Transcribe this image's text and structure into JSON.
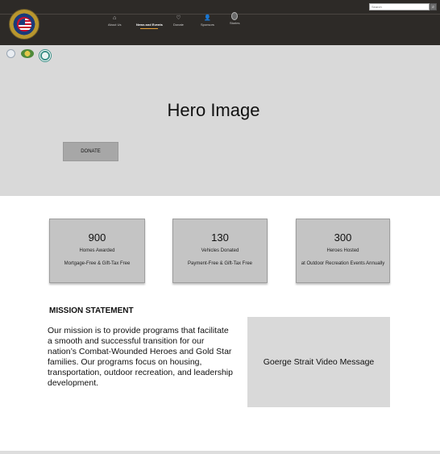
{
  "header": {
    "search_placeholder": "Search",
    "nav": [
      {
        "label": "About Us",
        "icon": "home-icon"
      },
      {
        "label": "News and Events",
        "icon": "none"
      },
      {
        "label": "Donate",
        "icon": "heart-icon"
      },
      {
        "label": "Sponsors",
        "icon": "person-icon"
      },
      {
        "label": "Stories",
        "icon": "badge-icon"
      }
    ],
    "active_nav": "News and Events",
    "accent_color": "#e8a33a"
  },
  "hero": {
    "title": "Hero Image",
    "donate_label": "DONATE"
  },
  "stats": [
    {
      "number": "900",
      "line1": "Homes Awarded",
      "line2": "Mortgage-Free & Gift-Tax Free"
    },
    {
      "number": "130",
      "line1": "Vehicles Donated",
      "line2": "Payment-Free & Gift-Tax Free"
    },
    {
      "number": "300",
      "line1": "Heroes Hosted",
      "line2": "at Outdoor Recreation Events Annually"
    }
  ],
  "mission": {
    "heading": "MISSION STATEMENT",
    "text": "Our mission is to provide programs that facilitate a smooth and successful transition for our nation’s Combat-Wounded Heroes and Gold Star families. Our programs focus on housing, transportation, outdoor recreation, and leadership development."
  },
  "video": {
    "label": "Goerge Strait Video Message"
  }
}
